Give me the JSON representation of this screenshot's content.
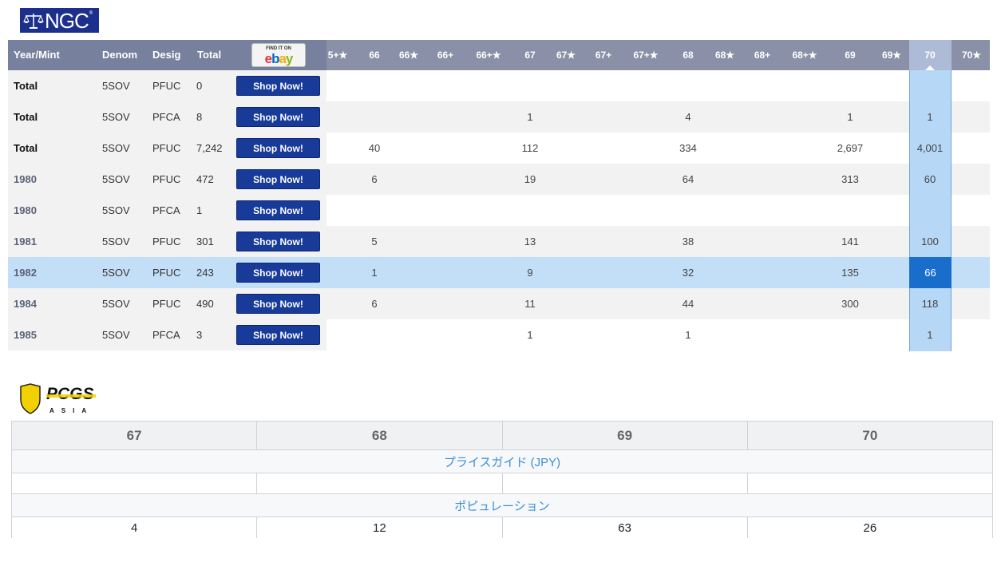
{
  "ngc": {
    "logo_text": "NGC",
    "logo_reg": "®",
    "headers": {
      "year": "Year/Mint",
      "denom": "Denom",
      "desig": "Desig",
      "total": "Total",
      "ebay_find": "FIND IT ON",
      "ebay_logo": "ebay"
    },
    "grade_headers": [
      "5+★",
      "66",
      "66★",
      "66+",
      "66+★",
      "67",
      "67★",
      "67+",
      "67+★",
      "68",
      "68★",
      "68+",
      "68+★",
      "69",
      "69★",
      "70",
      "70★"
    ],
    "shop_label": "Shop Now!",
    "rows": [
      {
        "year": "Total",
        "denom": "5SOV",
        "desig": "PFUC",
        "total": "0",
        "g66": "",
        "g67": "",
        "g68": "",
        "g69": "",
        "g70": ""
      },
      {
        "year": "Total",
        "denom": "5SOV",
        "desig": "PFCA",
        "total": "8",
        "g66": "",
        "g67": "1",
        "g68": "4",
        "g69": "1",
        "g70": "1"
      },
      {
        "year": "Total",
        "denom": "5SOV",
        "desig": "PFUC",
        "total": "7,242",
        "g66": "40",
        "g67": "112",
        "g68": "334",
        "g69": "2,697",
        "g70": "4,001"
      },
      {
        "year": "1980",
        "denom": "5SOV",
        "desig": "PFUC",
        "total": "472",
        "g66": "6",
        "g67": "19",
        "g68": "64",
        "g69": "313",
        "g70": "60"
      },
      {
        "year": "1980",
        "denom": "5SOV",
        "desig": "PFCA",
        "total": "1",
        "g66": "",
        "g67": "",
        "g68": "",
        "g69": "",
        "g70": ""
      },
      {
        "year": "1981",
        "denom": "5SOV",
        "desig": "PFUC",
        "total": "301",
        "g66": "5",
        "g67": "13",
        "g68": "38",
        "g69": "141",
        "g70": "100"
      },
      {
        "year": "1982",
        "denom": "5SOV",
        "desig": "PFUC",
        "total": "243",
        "g66": "1",
        "g67": "9",
        "g68": "32",
        "g69": "135",
        "g70": "66"
      },
      {
        "year": "1984",
        "denom": "5SOV",
        "desig": "PFUC",
        "total": "490",
        "g66": "6",
        "g67": "11",
        "g68": "44",
        "g69": "300",
        "g70": "118"
      },
      {
        "year": "1985",
        "denom": "5SOV",
        "desig": "PFCA",
        "total": "3",
        "g66": "",
        "g67": "1",
        "g68": "1",
        "g69": "",
        "g70": "1"
      }
    ],
    "colors": {
      "header_bg": "#77809c",
      "button_bg": "#183a98",
      "highlight_row": "#c3dff7",
      "highlight_cell": "#1a6ecb"
    }
  },
  "pcgs": {
    "logo_text": "PCGS",
    "logo_sub": "ASIA",
    "grades": [
      "67",
      "68",
      "69",
      "70"
    ],
    "price_guide_label": "プライスガイド (JPY)",
    "population_label": "ポピュレーション",
    "population": [
      "4",
      "12",
      "63",
      "26"
    ]
  }
}
